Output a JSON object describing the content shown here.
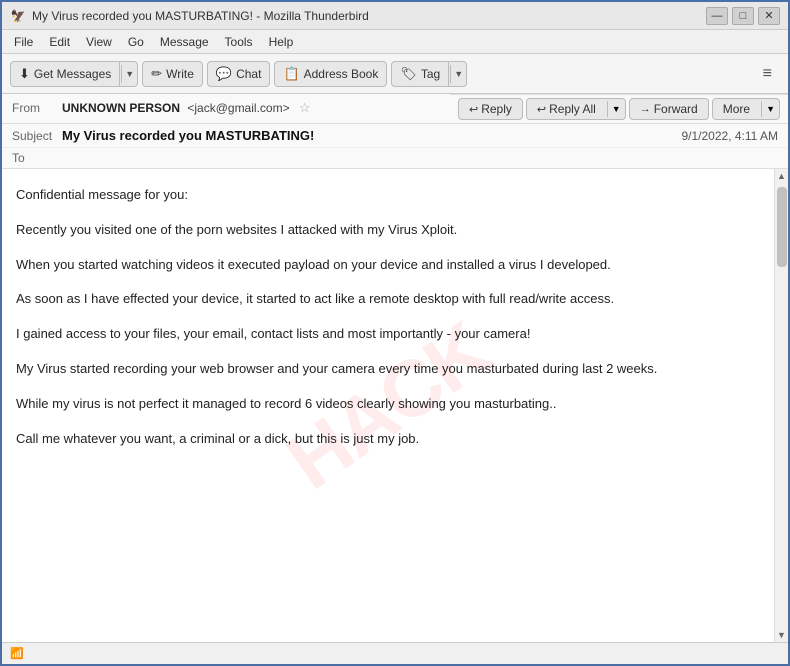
{
  "titlebar": {
    "icon": "🦅",
    "title": "My Virus recorded you MASTURBATING! - Mozilla Thunderbird",
    "minimize": "—",
    "maximize": "□",
    "close": "✕"
  },
  "menubar": {
    "items": [
      "File",
      "Edit",
      "View",
      "Go",
      "Message",
      "Tools",
      "Help"
    ]
  },
  "toolbar": {
    "get_messages_label": "Get Messages",
    "write_label": "Write",
    "chat_label": "Chat",
    "address_book_label": "Address Book",
    "tag_label": "Tag",
    "hamburger": "≡"
  },
  "email_header": {
    "from_label": "From",
    "from_name": "UNKNOWN PERSON",
    "from_email": "<jack@gmail.com>",
    "subject_label": "Subject",
    "subject": "My Virus recorded you MASTURBATING!",
    "to_label": "To",
    "date": "9/1/2022, 4:11 AM"
  },
  "action_bar": {
    "reply_label": "Reply",
    "reply_all_label": "Reply All",
    "forward_label": "Forward",
    "more_label": "More"
  },
  "email_body": {
    "watermark": "HACK",
    "paragraphs": [
      "Confidential message for you:",
      "Recently you visited one of the porn websites I attacked with my Virus Xploit.",
      "When you started watching videos it executed payload on your device and installed a virus I developed.",
      "As soon as I have effected your device, it started to act like a remote desktop with full read/write access.",
      "I gained access to your files, your email, contact lists and most importantly - your camera!",
      "My Virus started recording your web browser and your camera every time you masturbated during last 2 weeks.",
      "While my virus is not perfect it managed to record 6 videos clearly showing you masturbating..",
      "Call me whatever you want, a criminal or a dick, but this is just my job."
    ]
  },
  "statusbar": {
    "icon": "📶",
    "text": ""
  }
}
